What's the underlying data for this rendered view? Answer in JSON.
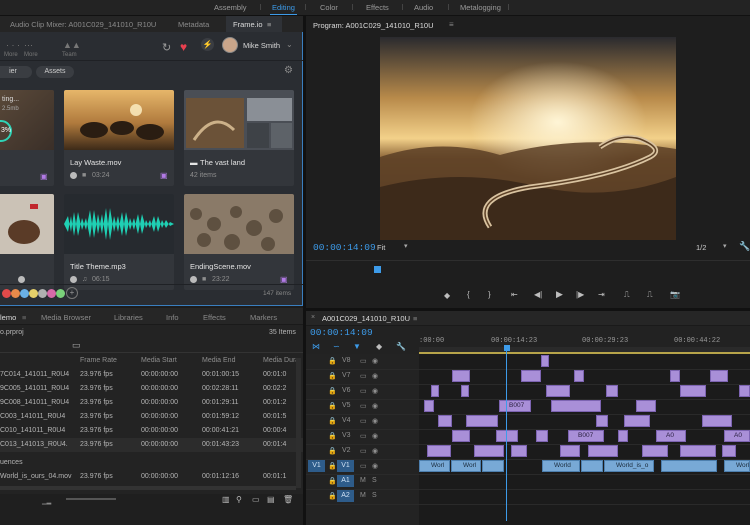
{
  "workspaces": [
    "Assembly",
    "Editing",
    "Color",
    "Effects",
    "Audio",
    "Metalogging"
  ],
  "active_workspace": "Editing",
  "top_tabs": {
    "audio_mixer": "Audio Clip Mixer: A001C029_141010_R10U",
    "metadata": "Metadata",
    "frameio": "Frame.io"
  },
  "frameio": {
    "nav": {
      "more": "More",
      "team": "Team"
    },
    "user": "Mike Smith",
    "filter": "ier",
    "folder": "Assets",
    "upload_status": "ting...",
    "upload_size": "2.5mb",
    "upload_percent": "3%",
    "cards": [
      {
        "title": "Lay Waste.mov",
        "meta": "03:24"
      },
      {
        "title": "The vast land",
        "meta": "42 items"
      },
      {
        "title": "Title Theme.mp3",
        "meta": "06:15"
      },
      {
        "title": "EndingScene.mov",
        "meta": "23:22"
      }
    ],
    "item_count": "147 items",
    "brand_color": "#3d9be9",
    "heart_color": "#e8404f"
  },
  "project": {
    "tabs": [
      "lemo",
      "Media Browser",
      "Libraries",
      "Info",
      "Effects",
      "Markers"
    ],
    "file": "o.prproj",
    "items_count": "35 Items",
    "columns": [
      "Frame Rate",
      "Media Start",
      "Media End",
      "Media Dura"
    ],
    "rows": [
      {
        "name": "7C014_141011_R0U4",
        "rate": "23.976 fps",
        "start": "00:00:00:00",
        "end": "00:01:00:15",
        "dur": "00:01:0"
      },
      {
        "name": "9C005_141011_R0U4",
        "rate": "23.976 fps",
        "start": "00:00:00:00",
        "end": "00:02:28:11",
        "dur": "00:02:2"
      },
      {
        "name": "9C008_141011_R0U4",
        "rate": "23.976 fps",
        "start": "00:00:00:00",
        "end": "00:01:29:11",
        "dur": "00:01:2"
      },
      {
        "name": "C003_141011_R0U4",
        "rate": "23.976 fps",
        "start": "00:00:00:00",
        "end": "00:01:59:12",
        "dur": "00:01:5"
      },
      {
        "name": "C010_141011_R0U4",
        "rate": "23.976 fps",
        "start": "00:00:00:00",
        "end": "00:00:41:21",
        "dur": "00:00:4"
      },
      {
        "name": "C013_141013_R0U4.",
        "rate": "23.976 fps",
        "start": "00:00:00:00",
        "end": "00:01:43:23",
        "dur": "00:01:4"
      }
    ],
    "group_label": "uences",
    "seq_row": {
      "name": "World_is_ours_04.mov",
      "rate": "23.976 fps",
      "start": "00:00:00:00",
      "end": "00:01:12:16",
      "dur": "00:01:1"
    }
  },
  "program": {
    "title": "Program: A001C029_141010_R10U",
    "timecode": "00:00:14:09",
    "fit": "Fit",
    "resolution": "1/2"
  },
  "timeline": {
    "sequence": "A001C029_141010_R10U",
    "timecode": "00:00:14:09",
    "ruler": [
      ":00:00",
      "00:00:14:23",
      "00:00:29:23",
      "00:00:44:22"
    ],
    "video_tracks": [
      "V8",
      "V7",
      "V6",
      "V5",
      "V4",
      "V3",
      "V2",
      "V1"
    ],
    "audio_tracks": [
      "A1",
      "A2"
    ],
    "source_v": "V1",
    "source_a": "A1",
    "clip_labels": [
      "B007",
      "B007",
      "A0",
      "A0",
      "Worl",
      "Worl",
      "World",
      "World",
      "World_is_o",
      "Worl"
    ]
  }
}
